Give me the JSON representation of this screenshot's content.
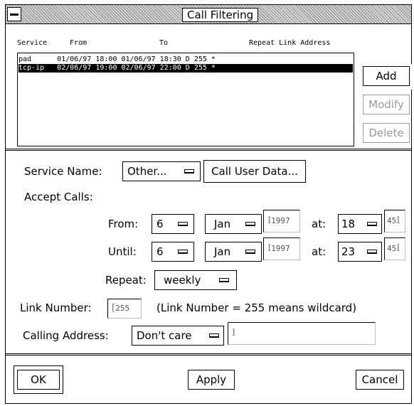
{
  "window": {
    "title": "Call Filtering"
  },
  "list": {
    "headers": {
      "service": "Service",
      "from": "From",
      "to": "To",
      "repeat_link_address": "Repeat Link Address"
    },
    "rows": [
      {
        "text": "pad      01/06/97 18:00 01/06/97 18:30 D 255 *",
        "selected": false
      },
      {
        "text": "tcp-ip   02/06/97 19:00 02/06/97 22:00 D 255 *",
        "selected": true
      }
    ]
  },
  "side_buttons": {
    "add": "Add",
    "modify": "Modify",
    "delete": "Delete"
  },
  "form": {
    "service_name_label": "Service Name:",
    "service_name_value": "Other...",
    "call_user_data_button": "Call User Data...",
    "accept_calls_label": "Accept Calls:",
    "from_label": "From:",
    "until_label": "Until:",
    "at_label": "at:",
    "from": {
      "day": "6",
      "month": "Jan",
      "year": "1997",
      "hour": "18",
      "minute": "45"
    },
    "until": {
      "day": "6",
      "month": "Jan",
      "year": "1997",
      "hour": "23",
      "minute": "45"
    },
    "repeat_label": "Repeat:",
    "repeat_value": "weekly",
    "link_number_label": "Link Number:",
    "link_number_value": "255",
    "link_number_note": "(Link Number = 255 means wildcard)",
    "calling_address_label": "Calling Address:",
    "calling_address_value": "Don't care",
    "calling_address_input": ""
  },
  "footer": {
    "ok": "OK",
    "apply": "Apply",
    "cancel": "Cancel"
  }
}
